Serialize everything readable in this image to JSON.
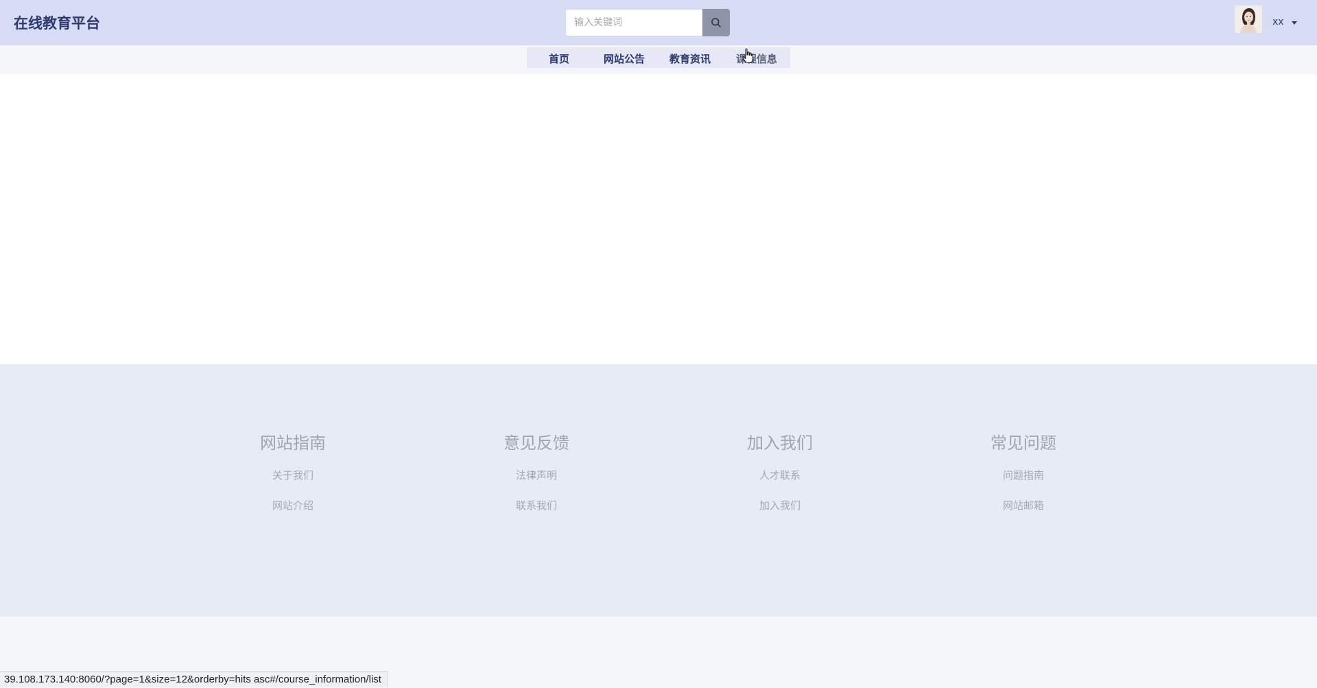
{
  "header": {
    "brand": "在线教育平台",
    "search": {
      "placeholder": "输入关键词",
      "value": "",
      "button_icon": "search-icon"
    },
    "user": {
      "name": "xx",
      "avatar": "avatar-photo",
      "menu_icon": "caret-down-icon"
    }
  },
  "nav": {
    "items": [
      {
        "label": "首页"
      },
      {
        "label": "网站公告"
      },
      {
        "label": "教育资讯"
      },
      {
        "label": "课程信息"
      }
    ],
    "hovered_index": 3
  },
  "footer": {
    "columns": [
      {
        "title": "网站指南",
        "links": [
          "关于我们",
          "网站介绍"
        ]
      },
      {
        "title": "意见反馈",
        "links": [
          "法律声明",
          "联系我们"
        ]
      },
      {
        "title": "加入我们",
        "links": [
          "人才联系",
          "加入我们"
        ]
      },
      {
        "title": "常见问题",
        "links": [
          "问题指南",
          "网站邮箱"
        ]
      }
    ]
  },
  "status_bar": {
    "url": "39.108.173.140:8060/?page=1&size=12&orderby=hits asc#/course_information/list"
  },
  "colors": {
    "header_bg": "#d6dcf4",
    "brand_text": "#2e3a6e",
    "footer_bg": "#e7ebf5",
    "search_button": "#8e94a6"
  }
}
